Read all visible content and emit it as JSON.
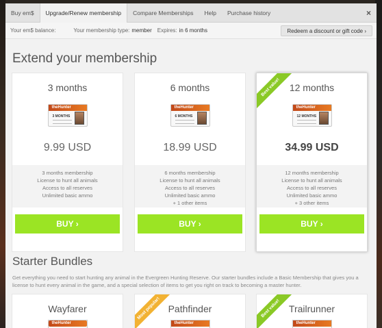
{
  "tabs": [
    {
      "label": "Buy em$"
    },
    {
      "label": "Upgrade/Renew membership"
    },
    {
      "label": "Compare Memberships"
    },
    {
      "label": "Help"
    },
    {
      "label": "Purchase history"
    }
  ],
  "close_label": "×",
  "infobar": {
    "balance_label": "Your em$ balance:",
    "membership_type_label": "Your membership type:",
    "membership_type_value": "member",
    "expires_label": "Expires:",
    "expires_value": "in 6 months",
    "redeem_label": "Redeem a discount or gift code ›"
  },
  "extend": {
    "title": "Extend your membership",
    "plans": [
      {
        "name": "3 months",
        "card_brand": "theHunter",
        "card_duration": "3 MONTHS",
        "price": "9.99 USD",
        "features": [
          "3 months membership",
          "License to hunt all animals",
          "Access to all reserves",
          "Unlimited basic ammo"
        ],
        "buy_label": "BUY ›"
      },
      {
        "name": "6 months",
        "card_brand": "theHunter",
        "card_duration": "6 MONTHS",
        "price": "18.99 USD",
        "features": [
          "6 months membership",
          "License to hunt all animals",
          "Access to all reserves",
          "Unlimited basic ammo",
          "+ 1 other items"
        ],
        "buy_label": "BUY ›"
      },
      {
        "name": "12 months",
        "card_brand": "theHunter",
        "card_duration": "12 MONTHS",
        "price": "34.99 USD",
        "ribbon": "Best value!",
        "features": [
          "12 months membership",
          "License to hunt all animals",
          "Access to all reserves",
          "Unlimited basic ammo",
          "+ 3 other items"
        ],
        "buy_label": "BUY ›"
      }
    ]
  },
  "bundles": {
    "title": "Starter Bundles",
    "description": "Get everything you need to start hunting any animal in the Evergreen Hunting Reserve. Our starter bundles include a Basic Membership that gives you a license to hunt every animal in the game, and a special selection of items to get you right on track to becoming a master hunter.",
    "items": [
      {
        "name": "Wayfarer",
        "card_brand": "theHunter"
      },
      {
        "name": "Pathfinder",
        "card_brand": "theHunter",
        "ribbon": "Most popular!"
      },
      {
        "name": "Trailrunner",
        "card_brand": "theHunter",
        "ribbon": "Best value!"
      }
    ]
  },
  "colors": {
    "buy_button": "#9be424",
    "ribbon_green": "#8ac926",
    "ribbon_orange": "#f2b233"
  }
}
